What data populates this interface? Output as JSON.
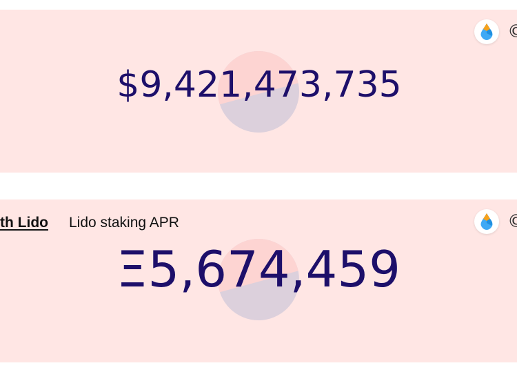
{
  "colors": {
    "card_background": "#ffe6e4",
    "amount_text": "#1d0f6a",
    "pie_major": "#dcd0dc",
    "pie_minor": "#fdd4d2"
  },
  "card_1": {
    "amount": "$9,421,473,735",
    "icon": "lido-drop-icon",
    "right_glyph": "©"
  },
  "card_2": {
    "link_label": "th Lido",
    "label": "Lido staking APR",
    "amount": "Ξ5,674,459",
    "icon": "lido-drop-icon",
    "right_glyph": "©"
  }
}
